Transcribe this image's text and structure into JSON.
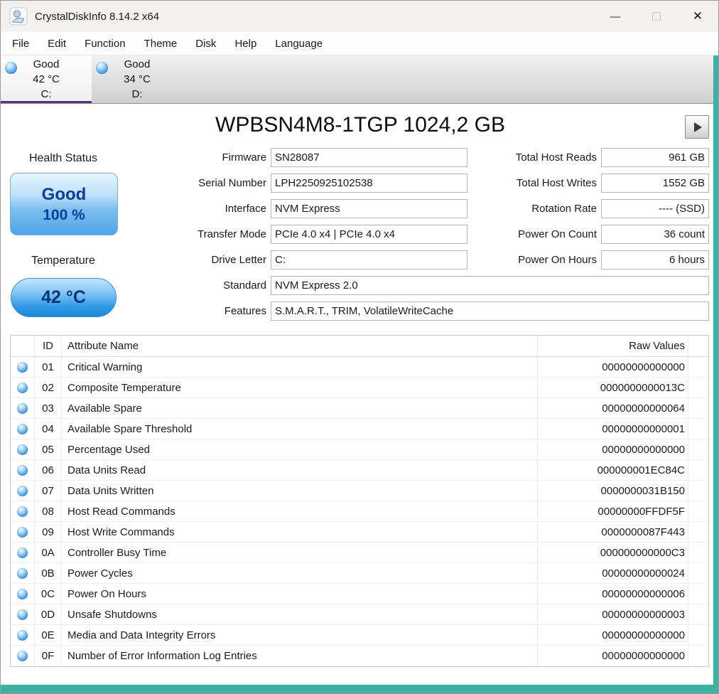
{
  "window": {
    "title": "CrystalDiskInfo 8.14.2 x64",
    "controls": {
      "minimize": "—",
      "close": "✕"
    }
  },
  "menu": [
    "File",
    "Edit",
    "Function",
    "Theme",
    "Disk",
    "Help",
    "Language"
  ],
  "tabs": [
    {
      "status": "Good",
      "temp": "42 °C",
      "letter": "C:",
      "selected": true
    },
    {
      "status": "Good",
      "temp": "34 °C",
      "letter": "D:",
      "selected": false
    }
  ],
  "drive": {
    "title": "WPBSN4M8-1TGP 1024,2 GB",
    "health_label": "Health Status",
    "health_status": "Good",
    "health_percent": "100 %",
    "temp_label": "Temperature",
    "temp_value": "42 °C"
  },
  "info_left": [
    {
      "label": "Firmware",
      "value": "SN28087"
    },
    {
      "label": "Serial Number",
      "value": "LPH2250925102538"
    },
    {
      "label": "Interface",
      "value": "NVM Express"
    },
    {
      "label": "Transfer Mode",
      "value": "PCIe 4.0 x4 | PCIe 4.0 x4"
    },
    {
      "label": "Drive Letter",
      "value": "C:"
    }
  ],
  "info_right": [
    {
      "label": "Total Host Reads",
      "value": "961 GB"
    },
    {
      "label": "Total Host Writes",
      "value": "1552 GB"
    },
    {
      "label": "Rotation Rate",
      "value": "---- (SSD)"
    },
    {
      "label": "Power On Count",
      "value": "36 count"
    },
    {
      "label": "Power On Hours",
      "value": "6 hours"
    }
  ],
  "info_wide": [
    {
      "label": "Standard",
      "value": "NVM Express 2.0"
    },
    {
      "label": "Features",
      "value": "S.M.A.R.T., TRIM, VolatileWriteCache"
    }
  ],
  "smart": {
    "headers": {
      "id": "ID",
      "name": "Attribute Name",
      "raw": "Raw Values"
    },
    "rows": [
      {
        "id": "01",
        "name": "Critical Warning",
        "raw": "00000000000000"
      },
      {
        "id": "02",
        "name": "Composite Temperature",
        "raw": "0000000000013C"
      },
      {
        "id": "03",
        "name": "Available Spare",
        "raw": "00000000000064"
      },
      {
        "id": "04",
        "name": "Available Spare Threshold",
        "raw": "00000000000001"
      },
      {
        "id": "05",
        "name": "Percentage Used",
        "raw": "00000000000000"
      },
      {
        "id": "06",
        "name": "Data Units Read",
        "raw": "000000001EC84C"
      },
      {
        "id": "07",
        "name": "Data Units Written",
        "raw": "0000000031B150"
      },
      {
        "id": "08",
        "name": "Host Read Commands",
        "raw": "00000000FFDF5F"
      },
      {
        "id": "09",
        "name": "Host Write Commands",
        "raw": "0000000087F443"
      },
      {
        "id": "0A",
        "name": "Controller Busy Time",
        "raw": "000000000000C3"
      },
      {
        "id": "0B",
        "name": "Power Cycles",
        "raw": "00000000000024"
      },
      {
        "id": "0C",
        "name": "Power On Hours",
        "raw": "00000000000006"
      },
      {
        "id": "0D",
        "name": "Unsafe Shutdowns",
        "raw": "00000000000003"
      },
      {
        "id": "0E",
        "name": "Media and Data Integrity Errors",
        "raw": "00000000000000"
      },
      {
        "id": "0F",
        "name": "Number of Error Information Log Entries",
        "raw": "00000000000000"
      }
    ]
  },
  "colors": {
    "accent_teal": "#3cb1a4",
    "selected_tab_purple": "#5a2d84",
    "health_good_blue": "#4fa5e9",
    "health_text_navy": "#0a3f96"
  }
}
